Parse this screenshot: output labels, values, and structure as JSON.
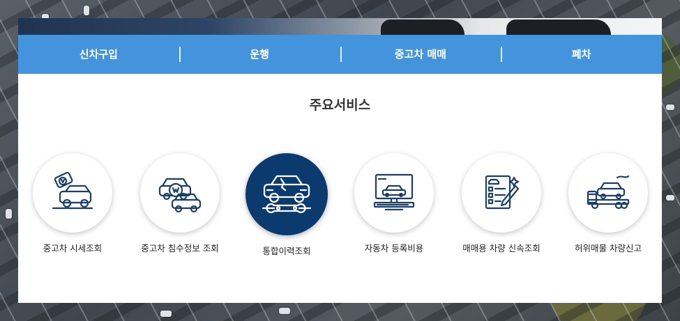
{
  "nav": {
    "items": [
      {
        "label": "신차구입"
      },
      {
        "label": "운행"
      },
      {
        "label": "중고차 매매"
      },
      {
        "label": "폐차"
      }
    ]
  },
  "main": {
    "title": "주요서비스",
    "services": [
      {
        "label": "중고차 시세조회",
        "icon": "car-price-tag-icon",
        "active": false
      },
      {
        "label": "중고차 침수정보 조회",
        "icon": "cars-won-coin-icon",
        "active": false
      },
      {
        "label": "통합이력조회",
        "icon": "car-wrench-history-icon",
        "active": true
      },
      {
        "label": "자동차 등록비용",
        "icon": "monitor-car-icon",
        "active": false
      },
      {
        "label": "매매용 차량 신속조회",
        "icon": "checklist-document-icon",
        "active": false
      },
      {
        "label": "허위매물 차량신고",
        "icon": "tow-truck-report-icon",
        "active": false
      }
    ]
  },
  "colors": {
    "nav_bg": "#4394dc",
    "active_circle": "#0b3a6e",
    "icon_stroke": "#1b3e66"
  }
}
